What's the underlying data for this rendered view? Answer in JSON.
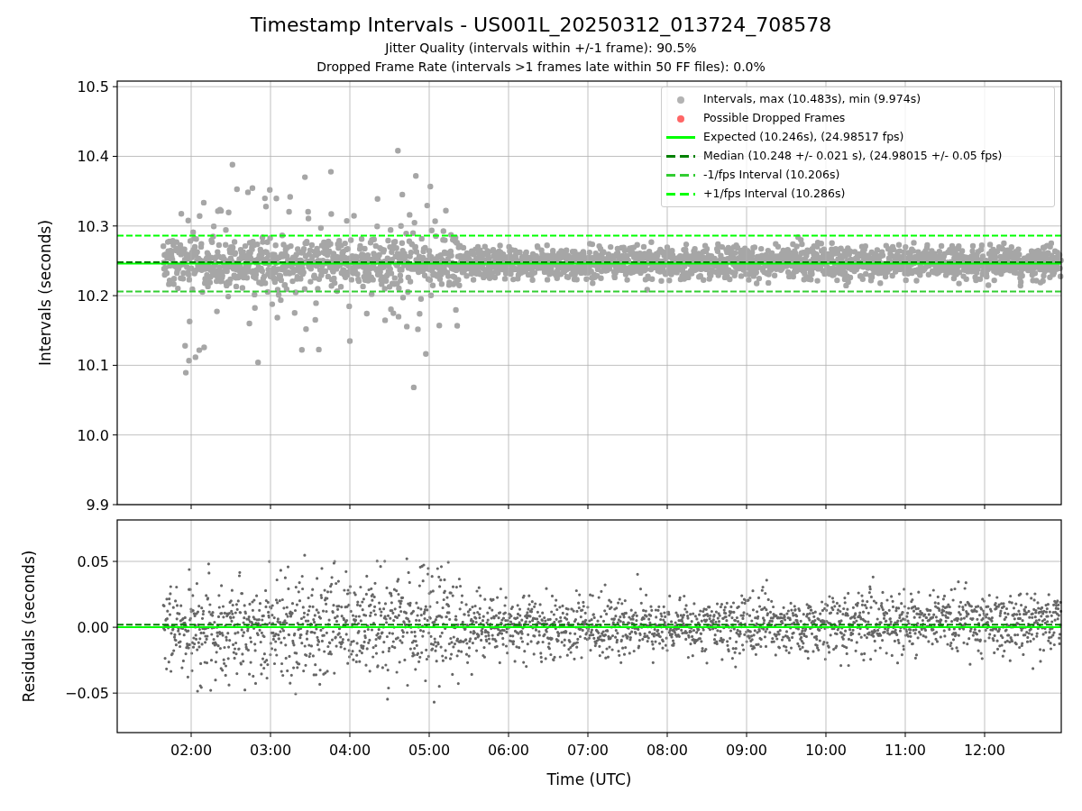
{
  "figure": {
    "title": "Timestamp Intervals - US001L_20250312_013724_708578",
    "subtitles": [
      "Jitter Quality (intervals within +/-1 frame): 90.5%",
      "Dropped Frame Rate (intervals >1 frames late within 50 FF files): 0.0%"
    ]
  },
  "intervals_panel": {
    "marker_legend": [
      {
        "label": "Intervals, max (10.483s), min (9.974s)",
        "color": "#b3b3b3"
      },
      {
        "label": "Possible Dropped Frames",
        "color": "#ff6666"
      }
    ],
    "chart_data": {
      "type": "line",
      "ylabel": "Intervals (seconds)",
      "x": [
        1.068,
        12.966
      ],
      "xlim": [
        1.068,
        12.966
      ],
      "ylim": [
        9.9,
        10.508
      ],
      "grid": true,
      "yticks": [
        {
          "value": 9.9,
          "label": "9.9"
        },
        {
          "value": 10.0,
          "label": "10.0"
        },
        {
          "value": 10.1,
          "label": "10.1"
        },
        {
          "value": 10.2,
          "label": "10.2"
        },
        {
          "value": 10.3,
          "label": "10.3"
        },
        {
          "value": 10.4,
          "label": "10.4"
        },
        {
          "value": 10.5,
          "label": "10.5"
        }
      ],
      "series": [
        {
          "name": "Expected (10.246s), (24.98517 fps)",
          "color": "#00ff00",
          "line_style": "solid",
          "values": [
            10.246,
            10.246
          ]
        },
        {
          "name": "Median (10.248 +/- 0.021 s), (24.98015 +/- 0.05 fps)",
          "color": "#008000",
          "line_style": "dashed",
          "values": [
            10.248,
            10.248
          ]
        },
        {
          "name": "-1/fps Interval (10.206s)",
          "color": "#32cd32",
          "line_style": "dashed",
          "values": [
            10.206,
            10.206
          ]
        },
        {
          "name": "+1/fps Interval (10.286s)",
          "color": "#00ff00",
          "line_style": "dashed",
          "values": [
            10.286,
            10.286
          ]
        }
      ]
    }
  },
  "residuals_panel": {
    "chart_data": {
      "type": "line",
      "xlabel": "Time (UTC)",
      "ylabel": "Residuals (seconds)",
      "x": [
        1.068,
        12.966
      ],
      "xlim": [
        1.068,
        12.966
      ],
      "ylim": [
        -0.08,
        0.0815
      ],
      "grid": true,
      "xticks": [
        {
          "value": 2,
          "label": "02:00"
        },
        {
          "value": 3,
          "label": "03:00"
        },
        {
          "value": 4,
          "label": "04:00"
        },
        {
          "value": 5,
          "label": "05:00"
        },
        {
          "value": 6,
          "label": "06:00"
        },
        {
          "value": 7,
          "label": "07:00"
        },
        {
          "value": 8,
          "label": "08:00"
        },
        {
          "value": 9,
          "label": "09:00"
        },
        {
          "value": 10,
          "label": "10:00"
        },
        {
          "value": 11,
          "label": "11:00"
        },
        {
          "value": 12,
          "label": "12:00"
        }
      ],
      "yticks": [
        {
          "value": -0.05,
          "label": "−0.05"
        },
        {
          "value": 0,
          "label": "0.00"
        },
        {
          "value": 0.05,
          "label": "0.05"
        }
      ],
      "series": [
        {
          "color": "#00ff00",
          "line_style": "solid",
          "values": [
            0,
            0
          ]
        },
        {
          "color": "#008000",
          "line_style": "dashed",
          "values": [
            0.002,
            0.002
          ]
        }
      ]
    }
  }
}
